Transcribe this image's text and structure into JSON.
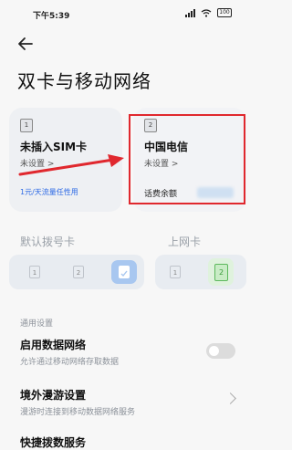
{
  "status_bar": {
    "time": "下午5:39",
    "battery": "100"
  },
  "page": {
    "title": "双卡与移动网络"
  },
  "sim_cards": [
    {
      "slot": "1",
      "name": "未插入SIM卡",
      "status": "未设置 >",
      "footer": "1元/天流量任性用"
    },
    {
      "slot": "2",
      "name": "中国电信",
      "status": "未设置 >",
      "balance_label": "话费余额"
    }
  ],
  "default_dial": {
    "label": "默认拨号卡",
    "options": [
      "1",
      "2"
    ]
  },
  "data_card": {
    "label": "上网卡",
    "options": [
      "1",
      "2"
    ],
    "selected": "2"
  },
  "general": {
    "section_label": "通用设置",
    "items": [
      {
        "title": "启用数据网络",
        "desc": "允许通过移动网络存取数据",
        "toggle": false
      },
      {
        "title": "境外漫游设置",
        "desc": "漫游时连接到移动数据网络服务"
      },
      {
        "title": "快捷拨数服务"
      }
    ]
  },
  "colors": {
    "highlight": "#e0282e",
    "accent": "#2f6be5"
  }
}
